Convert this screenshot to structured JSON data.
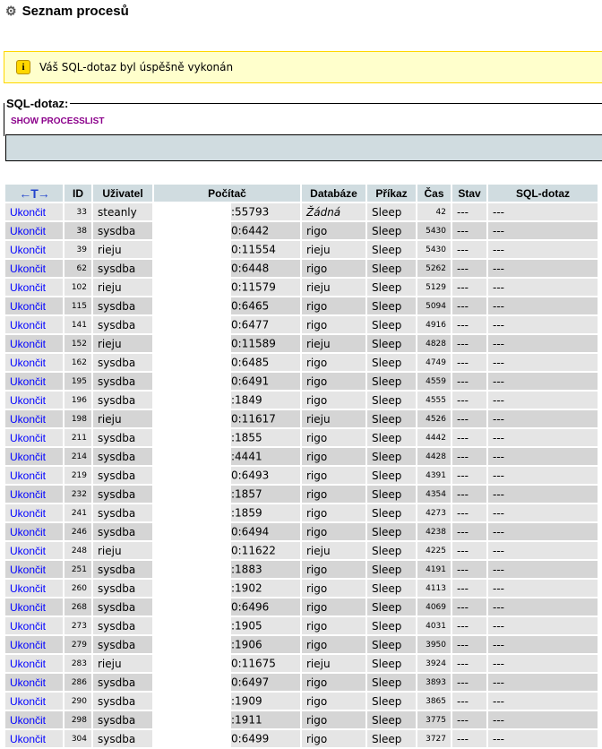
{
  "page": {
    "title": "Seznam procesů"
  },
  "notice": {
    "message": "Váš SQL-dotaz byl úspěšně vykonán"
  },
  "sql": {
    "legend": "SQL-dotaz:",
    "query": "SHOW PROCESSLIST"
  },
  "table": {
    "headers": {
      "arrows": "←T→",
      "id": "ID",
      "user": "Uživatel",
      "host": "Počítač",
      "db": "Databáze",
      "command": "Příkaz",
      "time": "Čas",
      "state": "Stav",
      "info": "SQL-dotaz"
    },
    "kill_label": "Ukončit",
    "rows": [
      {
        "id": "33",
        "user": "steanly",
        "host": ":55793",
        "db": "Žádná",
        "cmd": "Sleep",
        "time": "42",
        "state": "---",
        "info": "---"
      },
      {
        "id": "38",
        "user": "sysdba",
        "host": "0:6442",
        "db": "rigo",
        "cmd": "Sleep",
        "time": "5430",
        "state": "---",
        "info": "---"
      },
      {
        "id": "39",
        "user": "rieju",
        "host": "0:11554",
        "db": "rieju",
        "cmd": "Sleep",
        "time": "5430",
        "state": "---",
        "info": "---"
      },
      {
        "id": "62",
        "user": "sysdba",
        "host": "0:6448",
        "db": "rigo",
        "cmd": "Sleep",
        "time": "5262",
        "state": "---",
        "info": "---"
      },
      {
        "id": "102",
        "user": "rieju",
        "host": "0:11579",
        "db": "rieju",
        "cmd": "Sleep",
        "time": "5129",
        "state": "---",
        "info": "---"
      },
      {
        "id": "115",
        "user": "sysdba",
        "host": "0:6465",
        "db": "rigo",
        "cmd": "Sleep",
        "time": "5094",
        "state": "---",
        "info": "---"
      },
      {
        "id": "141",
        "user": "sysdba",
        "host": "0:6477",
        "db": "rigo",
        "cmd": "Sleep",
        "time": "4916",
        "state": "---",
        "info": "---"
      },
      {
        "id": "152",
        "user": "rieju",
        "host": "0:11589",
        "db": "rieju",
        "cmd": "Sleep",
        "time": "4828",
        "state": "---",
        "info": "---"
      },
      {
        "id": "162",
        "user": "sysdba",
        "host": "0:6485",
        "db": "rigo",
        "cmd": "Sleep",
        "time": "4749",
        "state": "---",
        "info": "---"
      },
      {
        "id": "195",
        "user": "sysdba",
        "host": "0:6491",
        "db": "rigo",
        "cmd": "Sleep",
        "time": "4559",
        "state": "---",
        "info": "---"
      },
      {
        "id": "196",
        "user": "sysdba",
        "host": ":1849",
        "db": "rigo",
        "cmd": "Sleep",
        "time": "4555",
        "state": "---",
        "info": "---"
      },
      {
        "id": "198",
        "user": "rieju",
        "host": "0:11617",
        "db": "rieju",
        "cmd": "Sleep",
        "time": "4526",
        "state": "---",
        "info": "---"
      },
      {
        "id": "211",
        "user": "sysdba",
        "host": ":1855",
        "db": "rigo",
        "cmd": "Sleep",
        "time": "4442",
        "state": "---",
        "info": "---"
      },
      {
        "id": "214",
        "user": "sysdba",
        "host": ":4441",
        "db": "rigo",
        "cmd": "Sleep",
        "time": "4428",
        "state": "---",
        "info": "---"
      },
      {
        "id": "219",
        "user": "sysdba",
        "host": "0:6493",
        "db": "rigo",
        "cmd": "Sleep",
        "time": "4391",
        "state": "---",
        "info": "---"
      },
      {
        "id": "232",
        "user": "sysdba",
        "host": ":1857",
        "db": "rigo",
        "cmd": "Sleep",
        "time": "4354",
        "state": "---",
        "info": "---"
      },
      {
        "id": "241",
        "user": "sysdba",
        "host": ":1859",
        "db": "rigo",
        "cmd": "Sleep",
        "time": "4273",
        "state": "---",
        "info": "---"
      },
      {
        "id": "246",
        "user": "sysdba",
        "host": "0:6494",
        "db": "rigo",
        "cmd": "Sleep",
        "time": "4238",
        "state": "---",
        "info": "---"
      },
      {
        "id": "248",
        "user": "rieju",
        "host": "0:11622",
        "db": "rieju",
        "cmd": "Sleep",
        "time": "4225",
        "state": "---",
        "info": "---"
      },
      {
        "id": "251",
        "user": "sysdba",
        "host": ":1883",
        "db": "rigo",
        "cmd": "Sleep",
        "time": "4191",
        "state": "---",
        "info": "---"
      },
      {
        "id": "260",
        "user": "sysdba",
        "host": ":1902",
        "db": "rigo",
        "cmd": "Sleep",
        "time": "4113",
        "state": "---",
        "info": "---"
      },
      {
        "id": "268",
        "user": "sysdba",
        "host": "0:6496",
        "db": "rigo",
        "cmd": "Sleep",
        "time": "4069",
        "state": "---",
        "info": "---"
      },
      {
        "id": "273",
        "user": "sysdba",
        "host": ":1905",
        "db": "rigo",
        "cmd": "Sleep",
        "time": "4031",
        "state": "---",
        "info": "---"
      },
      {
        "id": "279",
        "user": "sysdba",
        "host": ":1906",
        "db": "rigo",
        "cmd": "Sleep",
        "time": "3950",
        "state": "---",
        "info": "---"
      },
      {
        "id": "283",
        "user": "rieju",
        "host": "0:11675",
        "db": "rieju",
        "cmd": "Sleep",
        "time": "3924",
        "state": "---",
        "info": "---"
      },
      {
        "id": "286",
        "user": "sysdba",
        "host": "0:6497",
        "db": "rigo",
        "cmd": "Sleep",
        "time": "3893",
        "state": "---",
        "info": "---"
      },
      {
        "id": "290",
        "user": "sysdba",
        "host": ":1909",
        "db": "rigo",
        "cmd": "Sleep",
        "time": "3865",
        "state": "---",
        "info": "---"
      },
      {
        "id": "298",
        "user": "sysdba",
        "host": ":1911",
        "db": "rigo",
        "cmd": "Sleep",
        "time": "3775",
        "state": "---",
        "info": "---"
      },
      {
        "id": "304",
        "user": "sysdba",
        "host": "0:6499",
        "db": "rigo",
        "cmd": "Sleep",
        "time": "3727",
        "state": "---",
        "info": "---"
      }
    ]
  }
}
